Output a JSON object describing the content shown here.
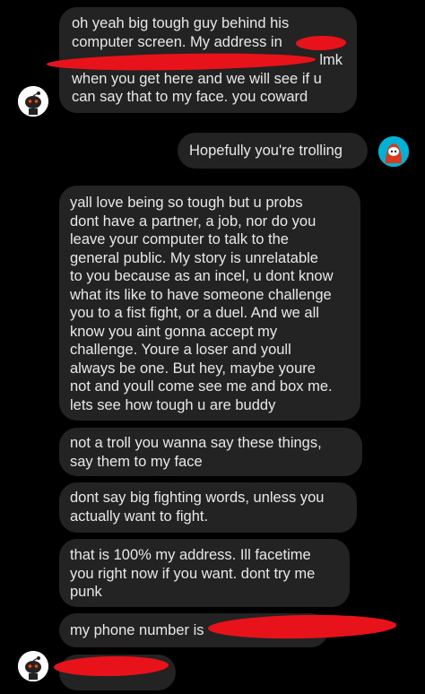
{
  "messages": [
    {
      "from": "them",
      "lines": [
        "oh yeah big tough guy behind his",
        "computer screen. My address in",
        "",
        "when you get here and we will see if u",
        "can say that to my face. you coward"
      ],
      "lmk": "lmk"
    },
    {
      "from": "me",
      "text": "Hopefully you're trolling"
    },
    {
      "from": "them",
      "text": "yall love being so tough but u probs\ndont have a partner, a job, nor do you\nleave your computer to talk to the\ngeneral public. My story is unrelatable\nto you because as an incel, u dont know\nwhat its like to have someone challenge\nyou to a fist fight, or a duel. And we all\nknow you aint gonna accept my\nchallenge. Youre a loser and youll\nalways be one. But hey, maybe youre\nnot and youll come see me and box me.\nlets see how tough u are buddy"
    },
    {
      "from": "them",
      "text": "not a troll you wanna say these things,\nsay them to my face"
    },
    {
      "from": "them",
      "text": "dont say big fighting words, unless you\nactually want to fight."
    },
    {
      "from": "them",
      "text": "that is 100% my address. Ill facetime\nyou right now if you want. dont try me\npunk"
    },
    {
      "from": "them",
      "text": "my phone number is"
    }
  ],
  "colors": {
    "bubble": "#232324",
    "redaction": "#e8131a",
    "avatar_me": "#00b2d6",
    "avatar_them": "#ffffff"
  },
  "icons": {
    "avatar_them": "snoo-avatar-icon",
    "avatar_me": "snoo-avatar-red-hood-icon"
  }
}
